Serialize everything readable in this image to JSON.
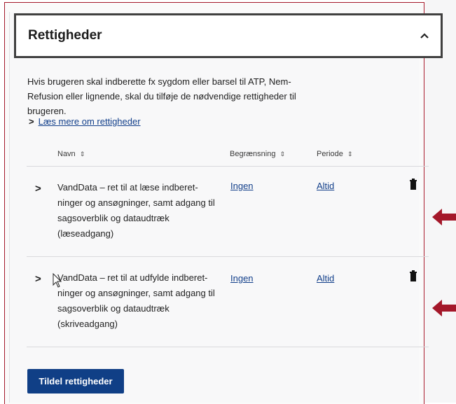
{
  "section": {
    "title": "Rettigheder",
    "intro": "Hvis brugeren skal indberette fx sygdom eller barsel til ATP, Nem-Refusion eller lignende, skal du tilføje de nødvendige rettigheder til brugeren.",
    "read_more_label": "Læs mere om rettigheder"
  },
  "table": {
    "columns": [
      {
        "label": "Navn"
      },
      {
        "label": "Begrænsning"
      },
      {
        "label": "Periode"
      }
    ],
    "rows": [
      {
        "name": "VandData – ret til at læse indberet-ninger og ansøgninger, samt adgang til sagsoverblik og dataudtræk (læseadgang)",
        "limitation": "Ingen",
        "period": "Altid"
      },
      {
        "name": "VandData – ret til at udfylde indberet-ninger og ansøgninger, samt adgang til sagsoverblik og dataudtræk (skriveadgang)",
        "limitation": "Ingen",
        "period": "Altid"
      }
    ]
  },
  "actions": {
    "assign_label": "Tildel rettigheder"
  },
  "icons": {
    "collapse": "chevron-up-icon",
    "expand": "chevron-right-icon",
    "sort": "sort-icon",
    "delete": "trash-icon",
    "annotation": "red-arrow-icon"
  },
  "colors": {
    "primary": "#103f86",
    "link": "#123f8a",
    "annotation": "#a4182a"
  }
}
